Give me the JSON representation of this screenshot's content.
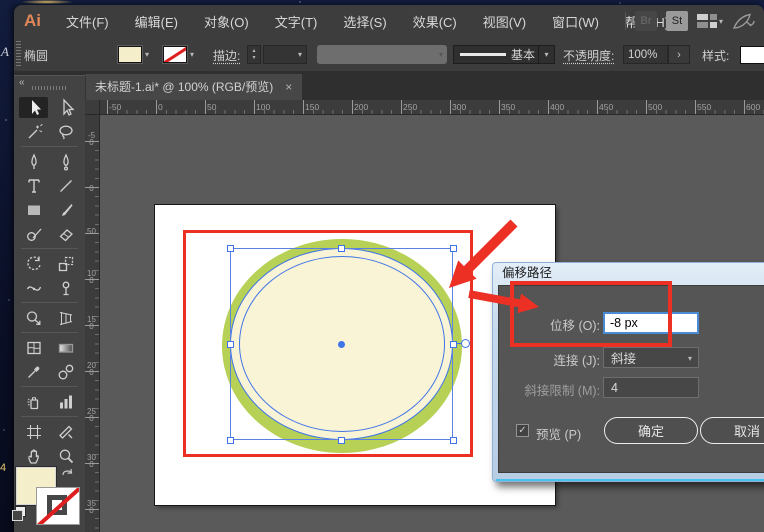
{
  "menubar": {
    "logo": "Ai",
    "items": [
      "文件(F)",
      "编辑(E)",
      "对象(O)",
      "文字(T)",
      "选择(S)",
      "效果(C)",
      "视图(V)",
      "窗口(W)",
      "帮助(H)"
    ],
    "bridge_badge": "Br",
    "stock_badge": "St"
  },
  "options": {
    "tool_name": "椭圆",
    "stroke_label": "描边:",
    "brush_preset": "基本",
    "opacity_label": "不透明度:",
    "opacity_value": "100%",
    "opacity_more": "›",
    "style_label": "样式:"
  },
  "tab": {
    "title": "未标题-1.ai* @ 100% (RGB/预览)",
    "close": "×"
  },
  "rulers": {
    "horizontal": [
      "-50",
      "0",
      "50",
      "100",
      "150",
      "200",
      "250",
      "300",
      "350",
      "400",
      "450",
      "500",
      "550",
      "600"
    ],
    "vertical": [
      "-50",
      "0",
      "50",
      "100",
      "150",
      "200",
      "250",
      "300",
      "350"
    ]
  },
  "toolbox": {
    "collapse": "«",
    "tools": [
      {
        "name": "selection-tool",
        "active": true
      },
      {
        "name": "direct-selection-tool",
        "active": false
      },
      {
        "name": "magic-wand-tool",
        "active": false
      },
      {
        "name": "lasso-tool",
        "active": false
      },
      {
        "name": "pen-tool",
        "active": false
      },
      {
        "name": "curvature-tool",
        "active": false
      },
      {
        "name": "type-tool",
        "active": false
      },
      {
        "name": "line-segment-tool",
        "active": false
      },
      {
        "name": "rectangle-tool",
        "active": false
      },
      {
        "name": "paintbrush-tool",
        "active": false
      },
      {
        "name": "shaper-tool",
        "active": false
      },
      {
        "name": "eraser-tool",
        "active": false
      },
      {
        "name": "rotate-tool",
        "active": false
      },
      {
        "name": "scale-tool",
        "active": false
      },
      {
        "name": "width-tool",
        "active": false
      },
      {
        "name": "puppet-warp-tool",
        "active": false
      },
      {
        "name": "shape-builder-tool",
        "active": false
      },
      {
        "name": "perspective-grid-tool",
        "active": false
      },
      {
        "name": "mesh-tool",
        "active": false
      },
      {
        "name": "gradient-tool",
        "active": false
      },
      {
        "name": "eyedropper-tool",
        "active": false
      },
      {
        "name": "blend-tool",
        "active": false
      },
      {
        "name": "symbol-sprayer-tool",
        "active": false
      },
      {
        "name": "column-graph-tool",
        "active": false
      },
      {
        "name": "artboard-tool",
        "active": false
      },
      {
        "name": "slice-tool",
        "active": false
      },
      {
        "name": "hand-tool",
        "active": false
      },
      {
        "name": "zoom-tool",
        "active": false
      }
    ]
  },
  "dialog": {
    "title": "偏移路径",
    "offset_label": "位移 (O):",
    "offset_value": "-8 px",
    "join_label": "连接 (J):",
    "join_value": "斜接",
    "miter_label": "斜接限制 (M):",
    "miter_value": "4",
    "preview_check": "✓",
    "preview_label": "预览 (P)",
    "ok_label": "确定",
    "cancel_label": "取消"
  },
  "desktop": {
    "artifact_a": "A",
    "artifact_4": "4"
  },
  "colors": {
    "annotation_red": "#ed3024",
    "selection_blue": "#3f74e8",
    "ellipse_green": "#b6d156",
    "ellipse_cream": "#faf4d6",
    "fill_swatch": "#f5eecb"
  }
}
